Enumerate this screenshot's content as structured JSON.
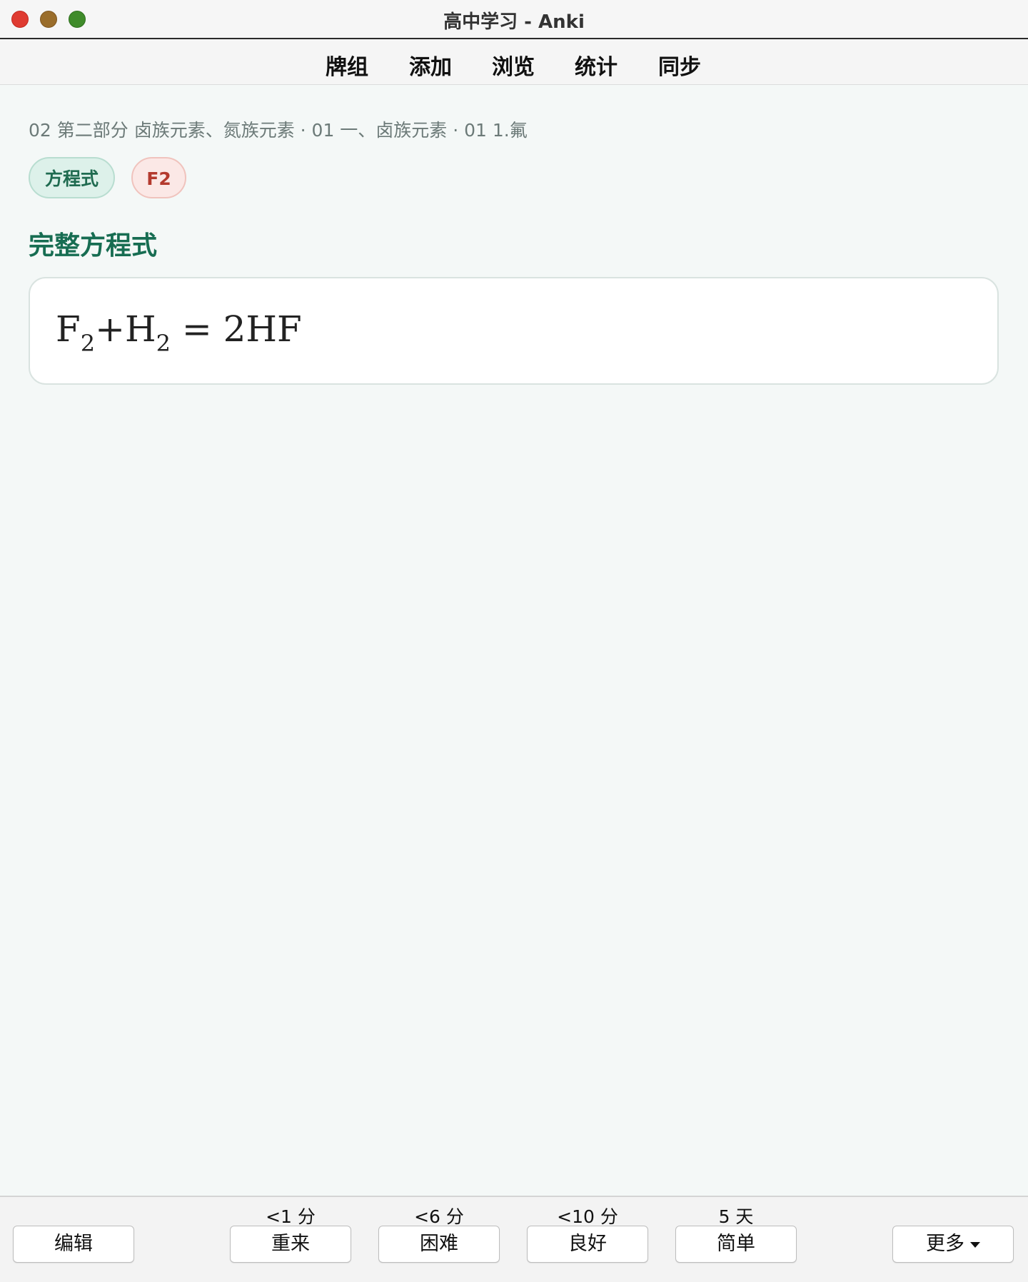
{
  "window": {
    "title": "高中学习 - Anki"
  },
  "toolbar": {
    "items": [
      "牌组",
      "添加",
      "浏览",
      "统计",
      "同步"
    ]
  },
  "card": {
    "breadcrumb": "02 第二部分 卤族元素、氮族元素 · 01 一、卤族元素 · 01 1.氟",
    "tags": [
      "方程式",
      "F2"
    ],
    "section_title": "完整方程式",
    "formula": {
      "f": "F",
      "sub1": "2",
      "plus": "+H",
      "sub2": "2",
      "rest": " = 2HF"
    }
  },
  "bottombar": {
    "edit_label": "编辑",
    "more_label": "更多",
    "answers": [
      {
        "interval": "<1 分",
        "label": "重来"
      },
      {
        "interval": "<6 分",
        "label": "困难"
      },
      {
        "interval": "<10 分",
        "label": "良好"
      },
      {
        "interval": "5 天",
        "label": "简单"
      }
    ]
  },
  "colors": {
    "accent_green": "#176d52",
    "tag_green_bg": "#ddf1ea",
    "tag_red_text": "#b43a2e",
    "window_close": "#df3b31",
    "window_minimize": "#9a6d2b",
    "window_maximize": "#3f8b2a"
  }
}
